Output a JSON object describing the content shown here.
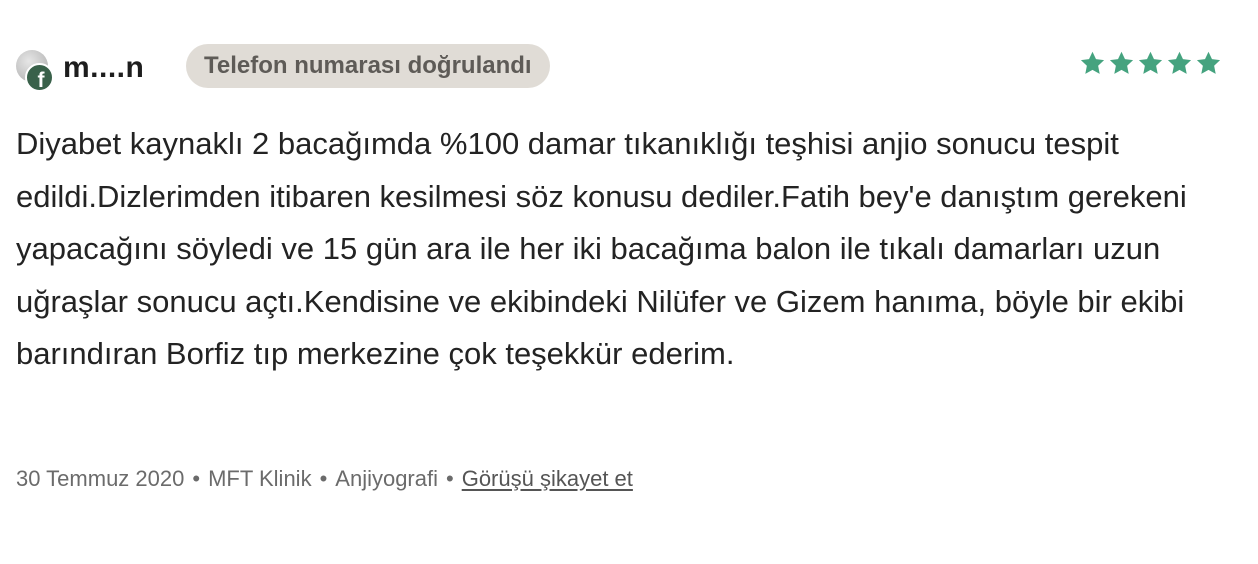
{
  "review": {
    "user": {
      "name": "m....n",
      "avatar_icon": "user-avatar-icon",
      "source_icon": "facebook-icon",
      "source_glyph": "f",
      "verified_label": "Telefon numarası doğrulandı"
    },
    "rating": {
      "value": 5,
      "max": 5,
      "icon": "star-icon",
      "color": "#45a37f"
    },
    "text": "Diyabet kaynaklı 2 bacağımda %100 damar tıkanıklığı teşhisi anjio sonucu tespit edildi.Dizlerimden itibaren kesilmesi söz konusu dediler.Fatih bey'e danıştım gerekeni yapacağını söyledi ve 15 gün ara ile her iki bacağıma balon ile tıkalı damarları uzun uğraşlar sonucu açtı.Kendisine ve ekibindeki Nilüfer ve Gizem hanıma, böyle bir ekibi barındıran Borfiz tıp merkezine çok teşekkür ederim.",
    "meta": {
      "date": "30 Temmuz 2020",
      "clinic": "MFT Klinik",
      "procedure": "Anjiyografi",
      "separator": "•",
      "report_link": "Görüşü şikayet et"
    }
  },
  "colors": {
    "badge_bg": "#e0dcd6",
    "facebook_badge": "#39614a",
    "text": "#232323",
    "meta_text": "#6b6b6b"
  }
}
